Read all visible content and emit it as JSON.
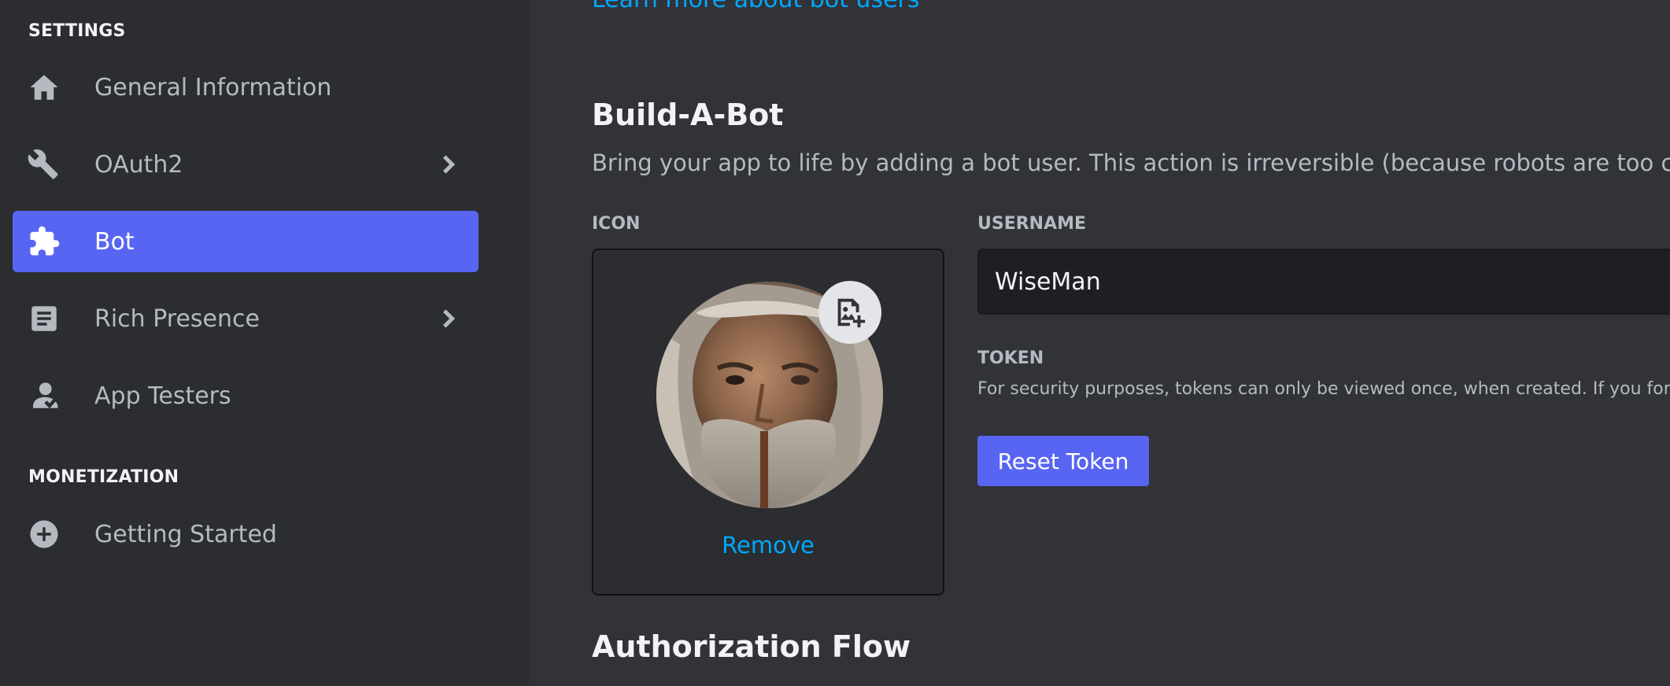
{
  "sidebar": {
    "settings_heading": "SETTINGS",
    "monetization_heading": "MONETIZATION",
    "items": [
      {
        "label": "General Information",
        "icon": "home-icon"
      },
      {
        "label": "OAuth2",
        "icon": "wrench-icon",
        "has_chevron": true
      },
      {
        "label": "Bot",
        "icon": "puzzle-icon",
        "active": true
      },
      {
        "label": "Rich Presence",
        "icon": "document-icon",
        "has_chevron": true
      },
      {
        "label": "App Testers",
        "icon": "person-icon"
      }
    ],
    "monetization_items": [
      {
        "label": "Getting Started",
        "icon": "plus-circle-icon"
      }
    ]
  },
  "main": {
    "learn_link": "Learn more about bot users",
    "build_title": "Build-A-Bot",
    "build_desc": "Bring your app to life by adding a bot user. This action is irreversible (because robots are too cool to de",
    "icon_label": "ICON",
    "remove_label": "Remove",
    "username_label": "USERNAME",
    "username_value": "WiseMan",
    "token_label": "TOKEN",
    "token_note": "For security purposes, tokens can only be viewed once, when created. If you forgot or lo",
    "reset_token_label": "Reset Token",
    "auth_flow_title": "Authorization Flow"
  },
  "colors": {
    "accent": "#5865f2",
    "link": "#00a8fc",
    "sidebar_bg": "#2b2d31",
    "main_bg": "#313338"
  }
}
